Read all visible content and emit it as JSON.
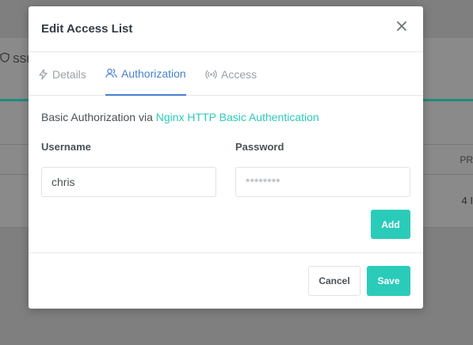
{
  "background": {
    "tab_ssl_label": "SSI",
    "col_header": "PR",
    "cell_value": "4 I"
  },
  "modal": {
    "title": "Edit Access List",
    "tabs": [
      {
        "label": "Details",
        "icon": "bolt-icon",
        "active": false
      },
      {
        "label": "Authorization",
        "icon": "users-icon",
        "active": true
      },
      {
        "label": "Access",
        "icon": "broadcast-icon",
        "active": false
      }
    ],
    "description_prefix": "Basic Authorization via ",
    "description_link": "Nginx HTTP Basic Authentication",
    "username_label": "Username",
    "password_label": "Password",
    "username_value": "chris",
    "password_placeholder": "********",
    "add_label": "Add",
    "cancel_label": "Cancel",
    "save_label": "Save"
  },
  "colors": {
    "accent": "#2bcbba",
    "active_tab": "#467fcf",
    "bg_underline": "#1f8a7d"
  }
}
